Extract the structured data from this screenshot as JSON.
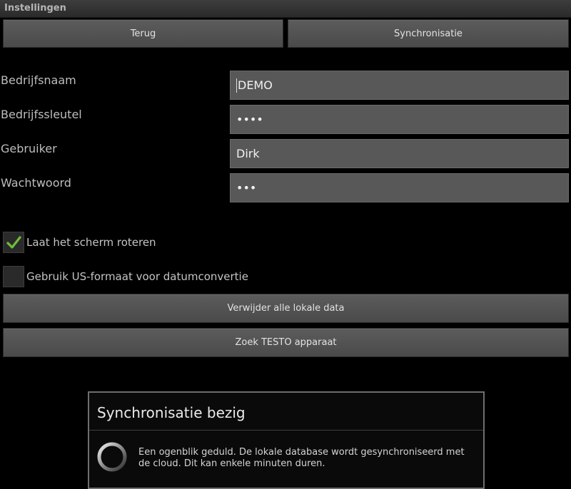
{
  "window": {
    "title": "Instellingen"
  },
  "toolbar": {
    "back_label": "Terug",
    "sync_label": "Synchronisatie"
  },
  "form": {
    "company_name": {
      "label": "Bedrijfsnaam",
      "value": "DEMO"
    },
    "company_key": {
      "label": "Bedrijfssleutel",
      "value": "••••"
    },
    "user": {
      "label": "Gebruiker",
      "value": "Dirk"
    },
    "password": {
      "label": "Wachtwoord",
      "value": "•••"
    }
  },
  "options": {
    "rotate_screen": {
      "label": "Laat het scherm roteren",
      "checked": true
    },
    "us_date_format": {
      "label": "Gebruik US-formaat voor datumconvertie",
      "checked": false
    }
  },
  "actions": {
    "delete_local_data": "Verwijder alle lokale data",
    "find_testo": "Zoek TESTO apparaat"
  },
  "dialog": {
    "title": "Synchronisatie bezig",
    "message": "Een ogenblik geduld. De lokale database wordt gesynchroniseerd met de cloud. Dit kan enkele minuten duren."
  },
  "colors": {
    "check_accent": "#6fbf3a",
    "background": "#000000",
    "button": "#545454"
  }
}
